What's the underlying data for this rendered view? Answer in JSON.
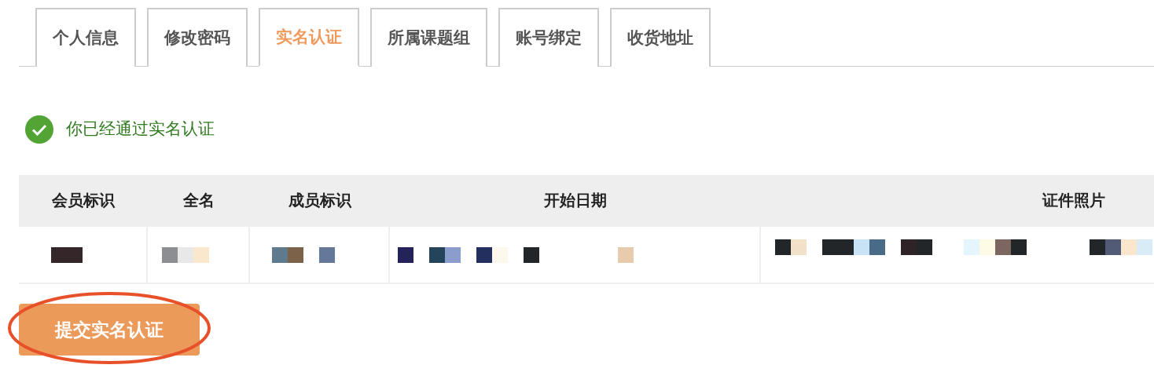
{
  "tabs": [
    {
      "label": "个人信息",
      "selected": false
    },
    {
      "label": "修改密码",
      "selected": false
    },
    {
      "label": "实名认证",
      "selected": true
    },
    {
      "label": "所属课题组",
      "selected": false
    },
    {
      "label": "账号绑定",
      "selected": false
    },
    {
      "label": "收货地址",
      "selected": false
    }
  ],
  "status": {
    "verified": true,
    "message": "你已经通过实名认证"
  },
  "table": {
    "columns": [
      "会员标识",
      "全名",
      "成员标识",
      "开始日期",
      "证件照片"
    ],
    "rows": [
      {
        "cells": [
          {
            "kind": "redacted"
          },
          {
            "kind": "redacted"
          },
          {
            "kind": "redacted"
          },
          {
            "kind": "redacted"
          },
          {
            "kind": "redacted"
          }
        ]
      }
    ]
  },
  "submit_button": {
    "label": "提交实名认证",
    "highlighted": true
  }
}
